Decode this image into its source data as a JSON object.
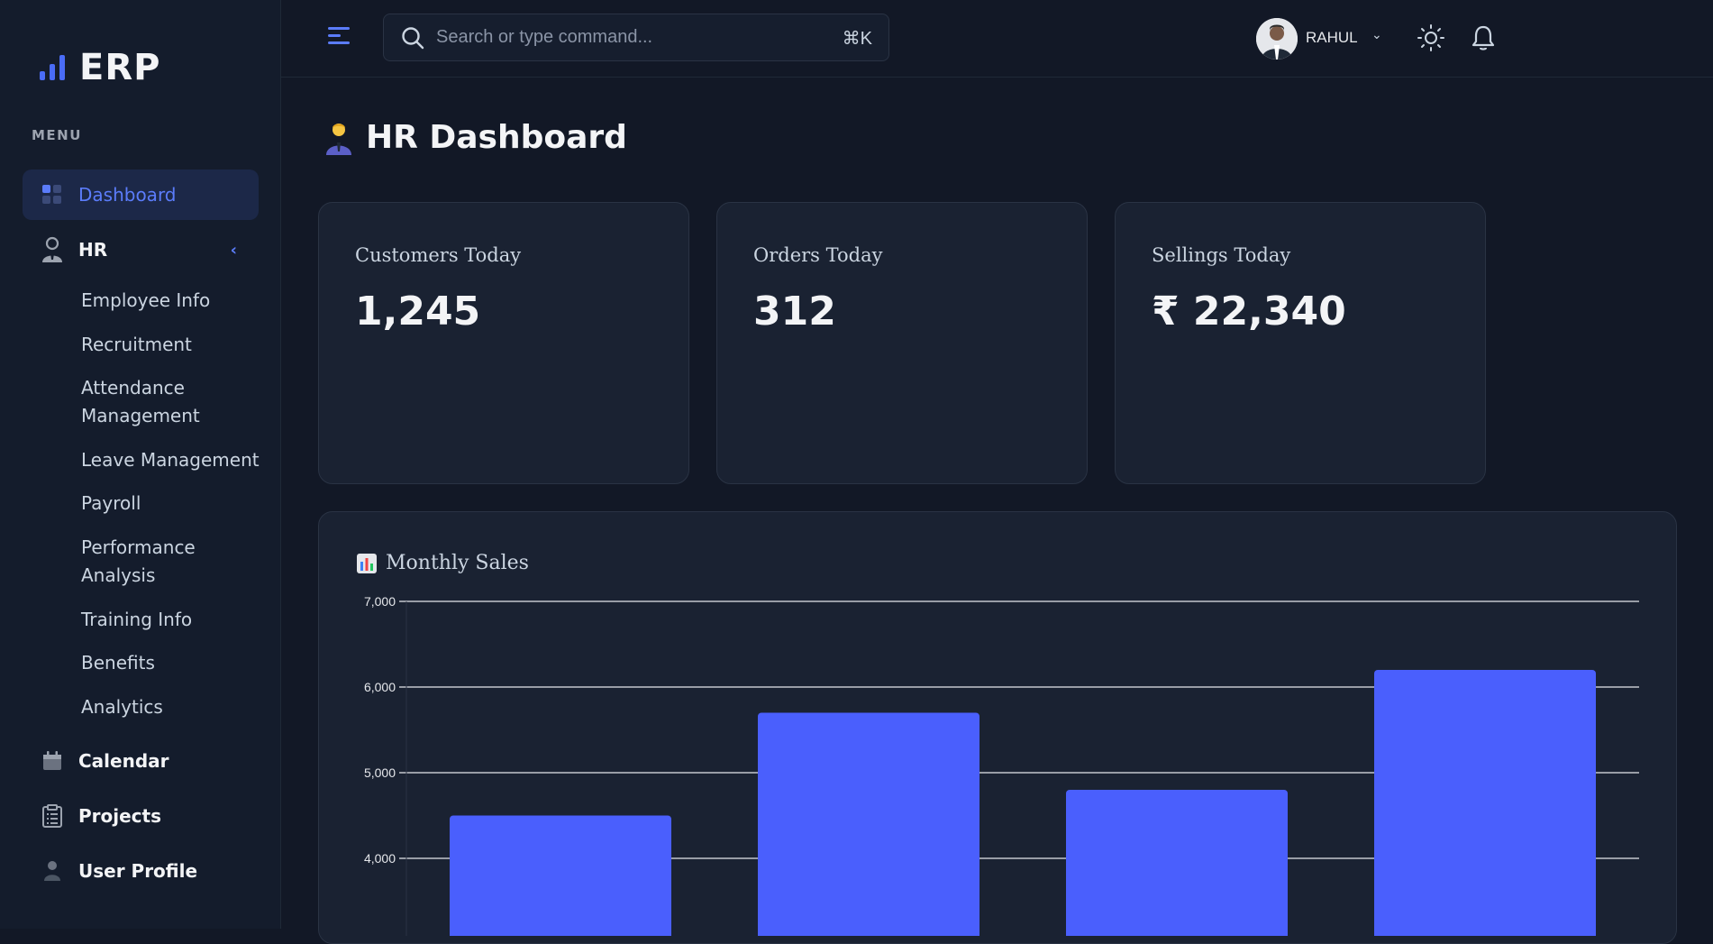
{
  "app": {
    "logo_text": "ERP"
  },
  "sidebar": {
    "menu_label": "MENU",
    "items": [
      {
        "label": "Dashboard",
        "icon": "grid-icon",
        "active": true
      },
      {
        "label": "HR",
        "icon": "user-tie-icon",
        "expanded": true
      },
      {
        "label": "Calendar",
        "icon": "calendar-icon"
      },
      {
        "label": "Projects",
        "icon": "clipboard-icon"
      },
      {
        "label": "User Profile",
        "icon": "user-icon"
      }
    ],
    "hr_subitems": [
      "Employee Info",
      "Recruitment",
      "Attendance Management",
      "Leave Management",
      "Payroll",
      "Performance Analysis",
      "Training Info",
      "Benefits",
      "Analytics"
    ]
  },
  "topbar": {
    "search_placeholder": "Search or type command...",
    "search_shortcut": "⌘K",
    "user_name": "RAHUL"
  },
  "main": {
    "title": "HR Dashboard",
    "cards": [
      {
        "label": "Customers Today",
        "value": "1,245"
      },
      {
        "label": "Orders Today",
        "value": "312"
      },
      {
        "label": "Sellings Today",
        "value": "₹ 22,340"
      }
    ]
  },
  "chart_data": {
    "type": "bar",
    "title": "Monthly Sales",
    "values": [
      4500,
      5700,
      4800,
      6200
    ],
    "yticks": [
      "4,000",
      "5,000",
      "6,000",
      "7,000"
    ],
    "ytick_values": [
      4000,
      5000,
      6000,
      7000
    ],
    "ylim": [
      4000,
      7000
    ],
    "grid": true,
    "color": "#4a5ffd"
  },
  "colors": {
    "accent": "#5b7cfa",
    "bar": "#4a5ffd",
    "background": "#121826",
    "card": "#1a2232"
  }
}
